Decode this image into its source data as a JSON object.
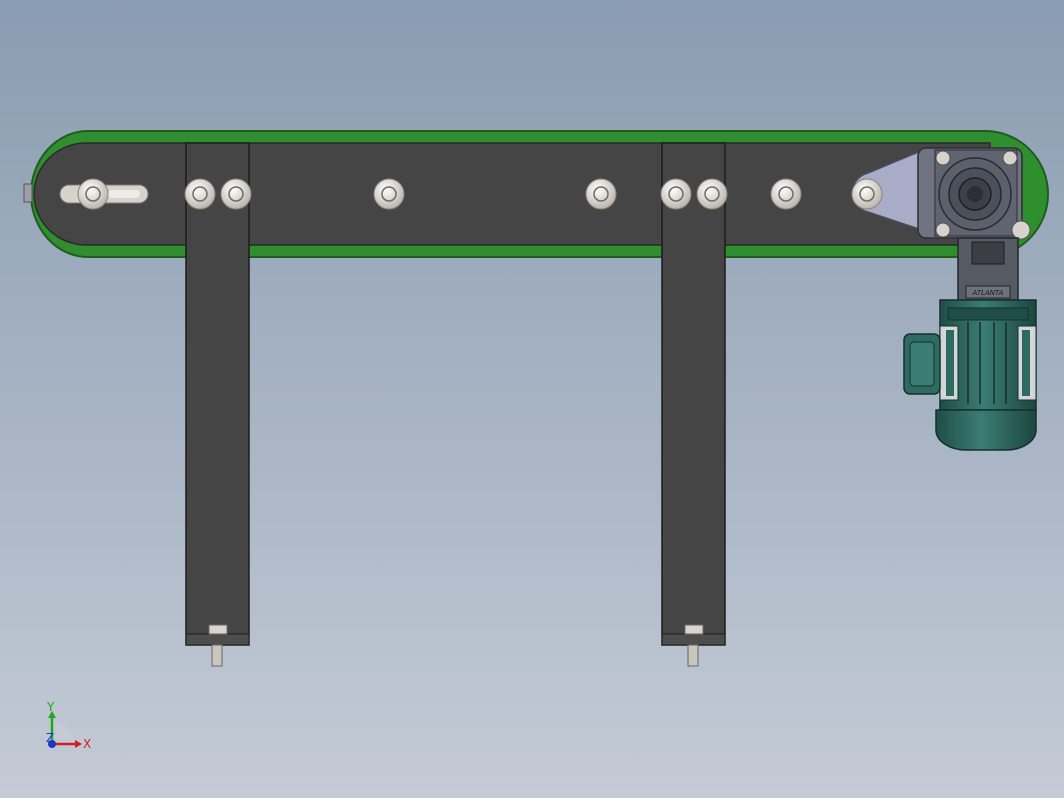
{
  "scene": {
    "model": "belt-conveyor-with-gear-motor",
    "view": "front",
    "background_top": "#8a9cb1",
    "background_bottom": "#c4cbd6"
  },
  "colors": {
    "belt": "#2f8f2f",
    "belt_edge": "#1f5d1f",
    "frame": "#454545",
    "roller": "#d9d5d0",
    "fastener": "#e3ddd6",
    "motor": "#2f6b62",
    "gearbox": "#5f6470",
    "bracket": "#a9acc6"
  },
  "components": {
    "bolts_on_rail": 9,
    "legs": 2,
    "rollers_visible": 5
  },
  "motor_label": "ATLANTA",
  "triad": {
    "x_label": "X",
    "y_label": "Y",
    "z_label": "Z",
    "x_color": "#d42020",
    "y_color": "#1ea81e",
    "z_color": "#2035d0"
  }
}
